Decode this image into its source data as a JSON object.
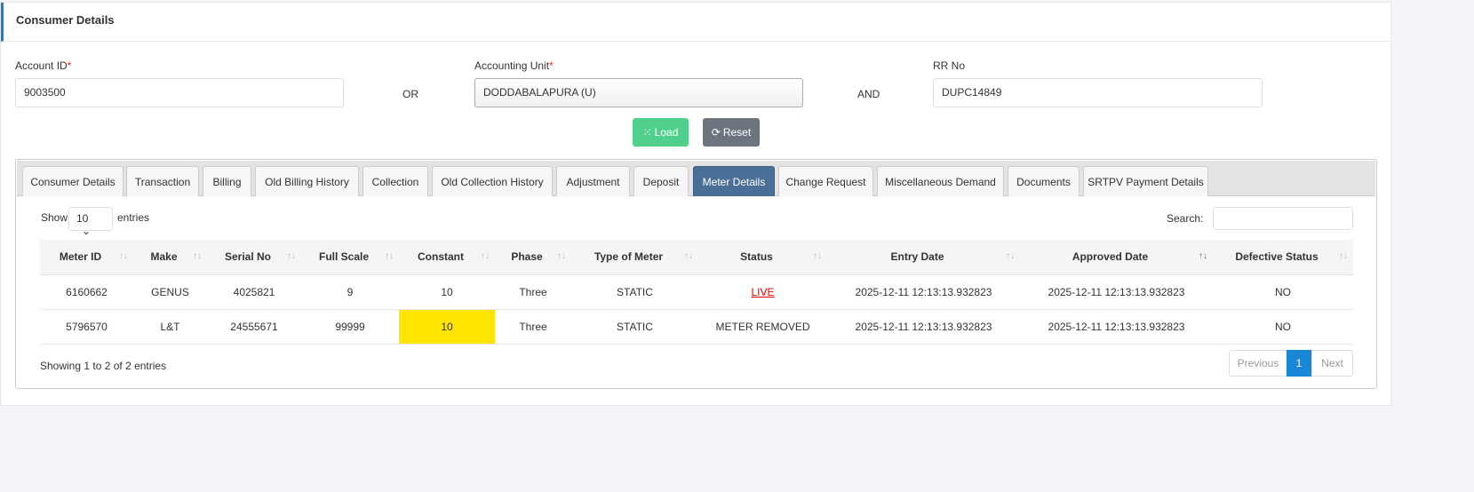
{
  "header": {
    "title": "Consumer Details"
  },
  "form": {
    "account_id_label": "Account ID",
    "account_id_value": "9003500",
    "or": "OR",
    "accounting_unit_label": "Accounting Unit",
    "accounting_unit_value": "DODDABALAPURA (U)",
    "and": "AND",
    "rr_label": "RR No",
    "rr_value": "DUPC14849",
    "required": "*",
    "load": "Load",
    "reset": "Reset"
  },
  "tabs": [
    "Consumer Details",
    "Transaction",
    "Billing",
    "Old Billing History",
    "Collection",
    "Old Collection History",
    "Adjustment",
    "Deposit",
    "Meter Details",
    "Change Request",
    "Miscellaneous Demand",
    "Documents",
    "SRTPV Payment Details"
  ],
  "active_tab": "Meter Details",
  "table": {
    "show": "Show",
    "entries_value": "10",
    "entries": "entries",
    "search_label": "Search:",
    "columns": [
      "Meter ID",
      "Make",
      "Serial No",
      "Full Scale",
      "Constant",
      "Phase",
      "Type of Meter",
      "Status",
      "Entry Date",
      "Approved Date",
      "Defective Status"
    ],
    "rows": [
      [
        "6160662",
        "GENUS",
        "4025821",
        "9",
        "10",
        "Three",
        "STATIC",
        "LIVE",
        "2025-12-11 12:13:13.932823",
        "2025-12-11 12:13:13.932823",
        "NO"
      ],
      [
        "5796570",
        "L&T",
        "24555671",
        "99999",
        "10",
        "Three",
        "STATIC",
        "METER REMOVED",
        "2025-12-11 12:13:13.932823",
        "2025-12-11 12:13:13.932823",
        "NO"
      ]
    ],
    "info": "Showing 1 to 2 of 2 entries",
    "previous": "Previous",
    "page": "1",
    "next": "Next"
  }
}
